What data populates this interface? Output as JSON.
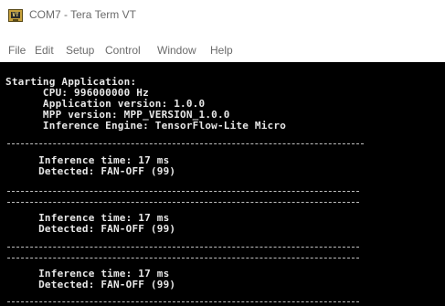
{
  "window": {
    "title": "COM7 - Tera Term VT",
    "icon": "tera-term-icon",
    "icon_text": "VT"
  },
  "menu": [
    "File",
    "Edit",
    "Setup",
    "Control",
    "Window",
    "Help"
  ],
  "terminal": {
    "header": [
      "Starting Application:",
      "      CPU: 996000000 Hz",
      "      Application version: 1.0.0",
      "      MPP version: MPP_VERSION_1.0.0",
      "      Inference Engine: TensorFlow-Lite Micro"
    ],
    "results": [
      {
        "time_line": "     Inference time: 17 ms",
        "detect_line": "     Detected: FAN-OFF (99)"
      },
      {
        "time_line": "     Inference time: 17 ms",
        "detect_line": "     Detected: FAN-OFF (99)"
      },
      {
        "time_line": "     Inference time: 17 ms",
        "detect_line": "     Detected: FAN-OFF (99)"
      }
    ]
  },
  "colors": {
    "terminal_bg": "#000000",
    "terminal_fg": "#e8e8e8",
    "chrome_text": "#6b6b6b"
  }
}
